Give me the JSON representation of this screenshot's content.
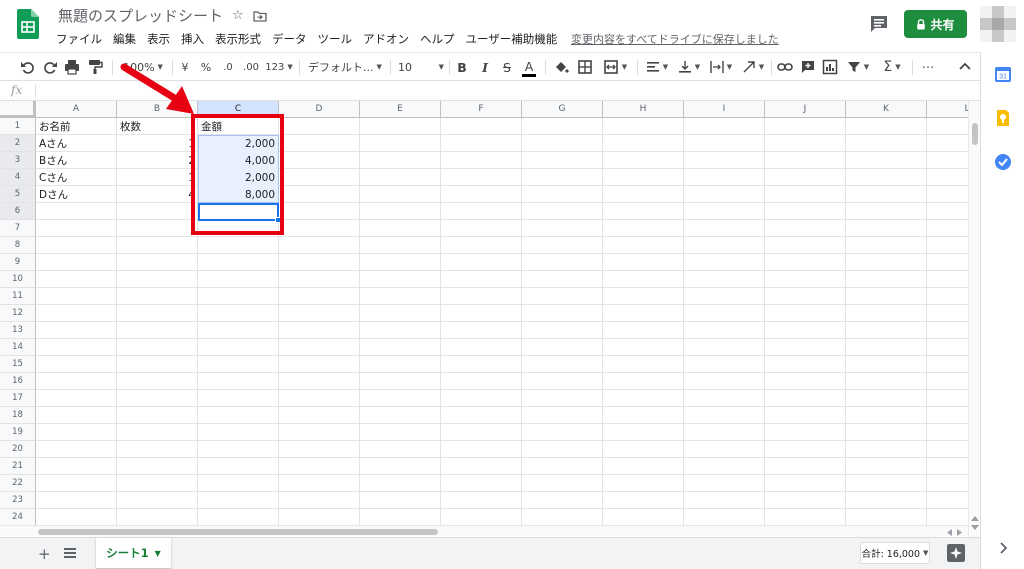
{
  "doc": {
    "title": "無題のスプレッドシート",
    "star_glyph": "☆",
    "folder_glyph": "⬚"
  },
  "menu": [
    "ファイル",
    "編集",
    "表示",
    "挿入",
    "表示形式",
    "データ",
    "ツール",
    "アドオン",
    "ヘルプ",
    "ユーザー補助機能"
  ],
  "save_status": "変更内容をすべてドライブに保存しました",
  "share": {
    "label": "共有",
    "color": "#1e8e3e"
  },
  "toolbar": {
    "zoom": "100%",
    "currency": "¥",
    "percent": "%",
    "dec_less": ".0",
    "dec_more": ".00",
    "format_more": "123",
    "font": "デフォルト...",
    "font_size": "10",
    "bold": "B",
    "italic": "I",
    "strike": "S",
    "text_color": "A",
    "more": "⋯",
    "collapse": "^"
  },
  "formula_bar": {
    "label": "fx",
    "value": ""
  },
  "columns": [
    "A",
    "B",
    "C",
    "D",
    "E",
    "F",
    "G",
    "H",
    "I",
    "J",
    "K",
    "L"
  ],
  "rows": [
    "1",
    "2",
    "3",
    "4",
    "5",
    "6",
    "7",
    "8",
    "9",
    "10",
    "11",
    "12",
    "13",
    "14",
    "15",
    "16",
    "17",
    "18",
    "19",
    "20",
    "21",
    "22",
    "23",
    "24"
  ],
  "cells": {
    "A1": "お名前",
    "B1": "枚数",
    "C1": "金額",
    "A2": "Aさん",
    "B2": "1",
    "C2": "2,000",
    "A3": "Bさん",
    "B3": "2",
    "C3": "4,000",
    "A4": "Cさん",
    "B4": "1",
    "C4": "2,000",
    "A5": "Dさん",
    "B5": "4",
    "C5": "8,000"
  },
  "sheet": {
    "tab_label": "シート1",
    "sum": "合計: 16,000",
    "add": "+"
  },
  "colors": {
    "accent": "#1a73e8",
    "selection_fill": "#e8f0fe",
    "highlight_box": "#e60012",
    "arrow": "#e60012"
  }
}
